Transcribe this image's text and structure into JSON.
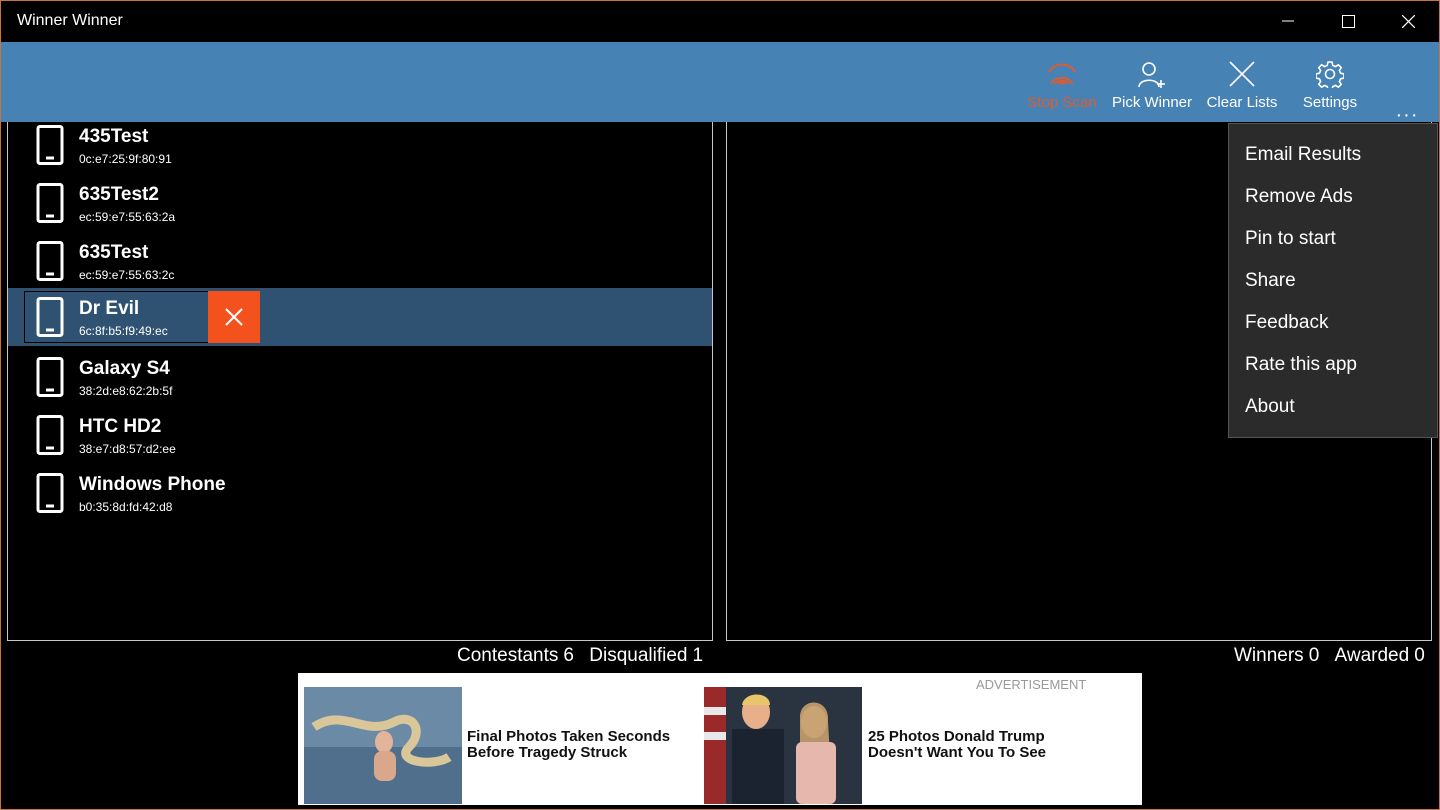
{
  "window": {
    "title": "Winner Winner"
  },
  "toolbar": {
    "stop_scan": "Stop Scan",
    "pick_winner": "Pick Winner",
    "clear_lists": "Clear Lists",
    "settings": "Settings",
    "more": "···"
  },
  "devices": [
    {
      "name": "435Test",
      "mac": "0c:e7:25:9f:80:91"
    },
    {
      "name": "635Test2",
      "mac": "ec:59:e7:55:63:2a"
    },
    {
      "name": "635Test",
      "mac": "ec:59:e7:55:63:2c"
    },
    {
      "name": "Dr Evil",
      "mac": "6c:8f:b5:f9:49:ec",
      "selected": true
    },
    {
      "name": "Galaxy S4",
      "mac": "38:2d:e8:62:2b:5f"
    },
    {
      "name": "HTC HD2",
      "mac": "38:e7:d8:57:d2:ee"
    },
    {
      "name": "Windows Phone",
      "mac": "b0:35:8d:fd:42:d8"
    }
  ],
  "stats": {
    "contestants_label": "Contestants",
    "contestants": "6",
    "disqualified_label": "Disqualified",
    "disqualified": "1",
    "winners_label": "Winners",
    "winners": "0",
    "awarded_label": "Awarded",
    "awarded": "0"
  },
  "menu": {
    "items": [
      "Email Results",
      "Remove Ads",
      "Pin to start",
      "Share",
      "Feedback",
      "Rate this app",
      "About"
    ]
  },
  "ad": {
    "label": "ADVERTISEMENT",
    "item1": "Final Photos Taken Seconds Before Tragedy Struck",
    "item2": "25 Photos Donald Trump Doesn't Want You To See"
  },
  "colors": {
    "accent": "#4682b4",
    "selected_row": "#2f5272",
    "delete": "#f3521c",
    "stop_scan": "#e05b2e"
  }
}
